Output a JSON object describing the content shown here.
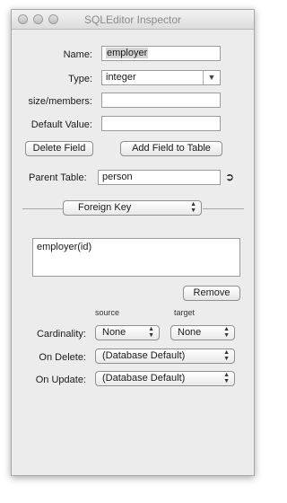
{
  "window": {
    "title": "SQLEditor Inspector"
  },
  "form": {
    "name_label": "Name:",
    "name_value": "employer",
    "type_label": "Type:",
    "type_value": "integer",
    "size_label": "size/members:",
    "size_value": "",
    "default_label": "Default Value:",
    "default_value": ""
  },
  "buttons": {
    "delete_field": "Delete Field",
    "add_field": "Add Field to Table",
    "remove": "Remove"
  },
  "parent": {
    "label": "Parent Table:",
    "value": "person"
  },
  "section": {
    "selected": "Foreign Key"
  },
  "keys": {
    "items": [
      "employer(id)"
    ]
  },
  "columns": {
    "source": "source",
    "target": "target"
  },
  "cardinality": {
    "label": "Cardinality:",
    "source_value": "None",
    "target_value": "None"
  },
  "on_delete": {
    "label": "On Delete:",
    "value": "(Database Default)"
  },
  "on_update": {
    "label": "On Update:",
    "value": "(Database Default)"
  }
}
